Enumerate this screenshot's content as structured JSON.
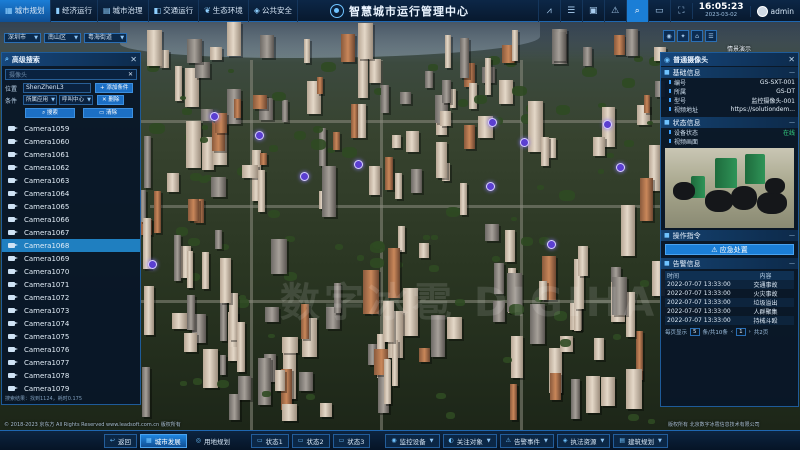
{
  "topbar": {
    "nav": [
      {
        "label": "城市规划",
        "icon": "grid-icon",
        "active": true
      },
      {
        "label": "经济运行",
        "icon": "chart-icon",
        "active": false
      },
      {
        "label": "城市治理",
        "icon": "building-icon",
        "active": false
      },
      {
        "label": "交通运行",
        "icon": "car-icon",
        "active": false
      },
      {
        "label": "生态环境",
        "icon": "leaf-icon",
        "active": false
      },
      {
        "label": "公共安全",
        "icon": "shield-icon",
        "active": false
      }
    ],
    "title": "智慧城市运行管理中心",
    "time": "16:05:23",
    "date": "2023-03-02",
    "user": "admin",
    "tools": [
      "chart-icon",
      "layers-icon",
      "image-icon",
      "alert-icon",
      "search-icon",
      "monitor-icon",
      "fullscreen-icon"
    ]
  },
  "breadcrumbs": [
    "深圳市",
    "南山区",
    "粤海街道"
  ],
  "left_panel": {
    "title": "高级搜索",
    "search_placeholder": "摄像头",
    "location_label": "位置",
    "location_value": "ShenZhenL3",
    "add_condition": "添加条件",
    "condition_label": "条件",
    "condition_field": "所属应用",
    "condition_value": "呼叫中心",
    "delete_label": "删除",
    "search_button": "搜索",
    "clear_button": "清除",
    "cameras": [
      "Camera1059",
      "Camera1060",
      "Camera1061",
      "Camera1062",
      "Camera1063",
      "Camera1064",
      "Camera1065",
      "Camera1066",
      "Camera1067",
      "Camera1068",
      "Camera1069",
      "Camera1070",
      "Camera1071",
      "Camera1072",
      "Camera1073",
      "Camera1074",
      "Camera1075",
      "Camera1076",
      "Camera1077",
      "Camera1078",
      "Camera1079"
    ],
    "selected_camera": "Camera1068",
    "footer": "搜索结果：找到1124，耗时0.175"
  },
  "right_panel": {
    "title": "普通摄像头",
    "basic_section": "基础信息",
    "fields": [
      {
        "key": "编号",
        "value": "GS-SXT-001"
      },
      {
        "key": "所属",
        "value": "GS-DT"
      },
      {
        "key": "型号",
        "value": "监控摄像头-001"
      },
      {
        "key": "视频地址",
        "value": "https://solutiondem..."
      }
    ],
    "status_section": "状态信息",
    "device_status_key": "设备状态",
    "device_status_value": "在线",
    "video_label": "视频画面",
    "ops_section": "操作指令",
    "emergency_button": "应急处置",
    "alarm_section": "告警信息",
    "alarm_headers": [
      "时间",
      "内容"
    ],
    "alarms": [
      {
        "time": "2022-07-07 13:33:00",
        "content": "交通事故"
      },
      {
        "time": "2022-07-07 13:33:00",
        "content": "火灾事故"
      },
      {
        "time": "2022-07-07 13:33:00",
        "content": "垃圾溢出"
      },
      {
        "time": "2022-07-07 13:33:00",
        "content": "人群聚集"
      },
      {
        "time": "2022-07-07 13:33:00",
        "content": "持械斗殴"
      }
    ],
    "pager_text": "每页显示",
    "pager_size": "5",
    "pager_total": "条/共10条",
    "pager_page": "1",
    "pager_count": "共2页"
  },
  "map_label": "情景演示",
  "bottom": {
    "back": "返回",
    "buttons": [
      {
        "label": "城市发展",
        "icon": "city-icon",
        "active": true
      },
      {
        "label": "用地规划",
        "icon": "map-icon",
        "active": false,
        "plain": true
      },
      {
        "label": "状态1",
        "icon": "state-icon",
        "active": false
      },
      {
        "label": "状态2",
        "icon": "state-icon",
        "active": false
      },
      {
        "label": "状态3",
        "icon": "state-icon",
        "active": false
      },
      {
        "label": "监控设备",
        "icon": "camera-icon",
        "active": false,
        "dropdown": true
      },
      {
        "label": "关注对象",
        "icon": "eye-icon",
        "active": false,
        "dropdown": true
      },
      {
        "label": "告警事件",
        "icon": "alarm-icon",
        "active": false,
        "dropdown": true
      },
      {
        "label": "执法资源",
        "icon": "badge-icon",
        "active": false,
        "dropdown": true
      },
      {
        "label": "建筑规划",
        "icon": "blueprint-icon",
        "active": false,
        "dropdown": true
      }
    ],
    "copyright_left": "© 2018-2023 京东方 All Rights Reserved www.leadsoft.com.cn 版权所有",
    "copyright_right": "版权所有 北京数字冰雹信息技术有限公司"
  },
  "watermark": "数字冰雹 DIGIHAIL"
}
